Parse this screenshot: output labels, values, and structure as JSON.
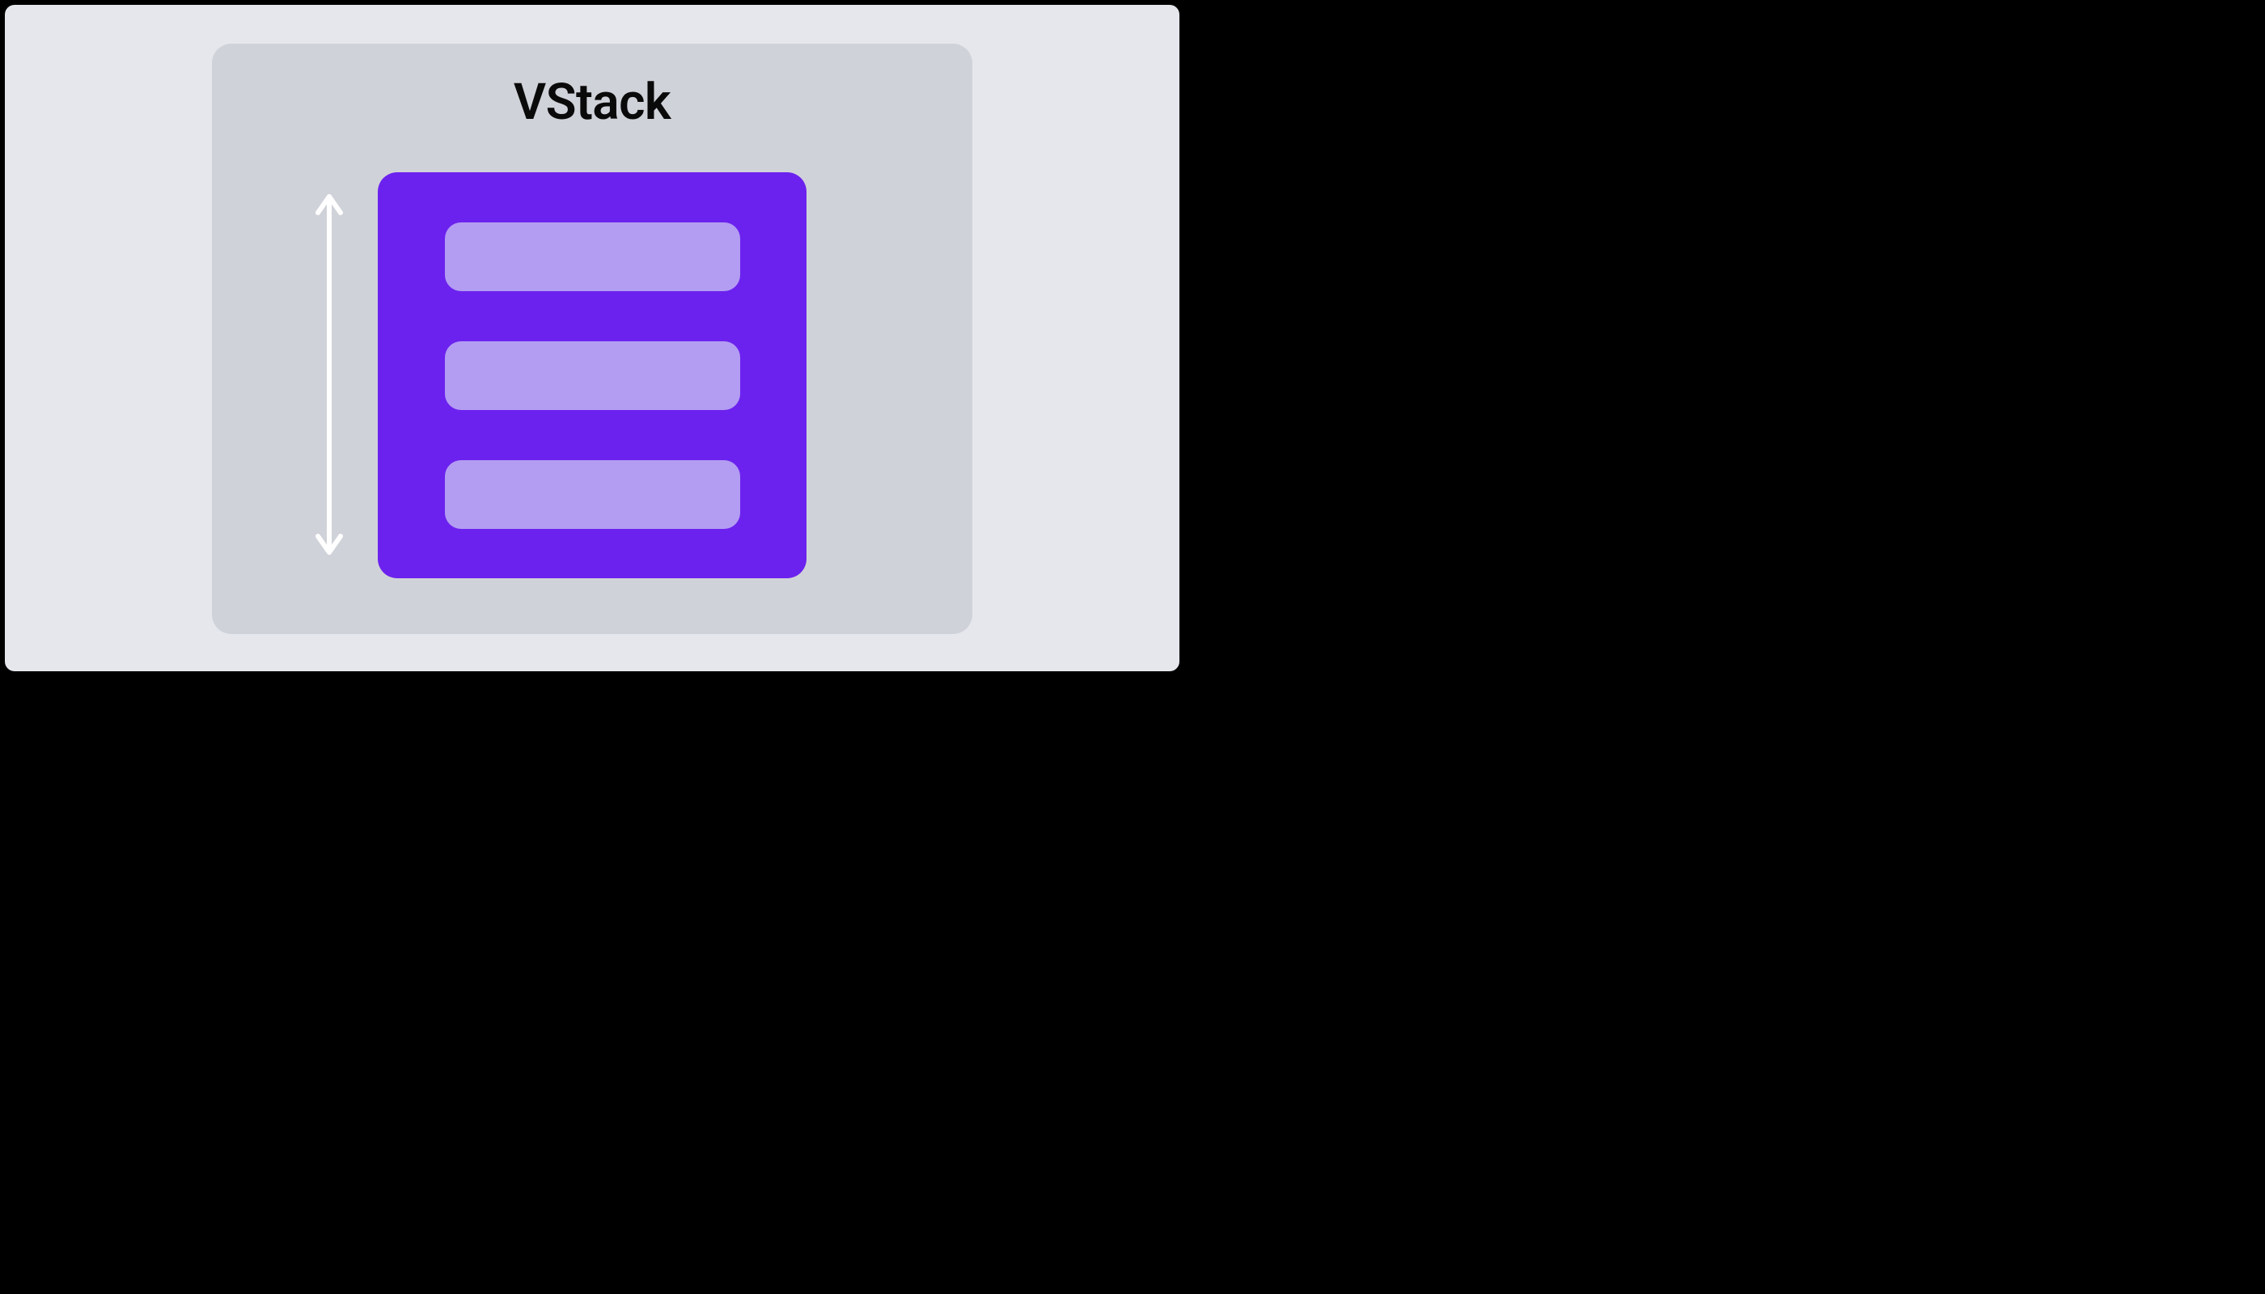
{
  "diagram": {
    "title": "VStack",
    "colors": {
      "page_bg": "#E5E7ED",
      "panel_bg": "#D0D2D9",
      "stack_bg": "#6C22EE",
      "item_bg": "#B39DF2",
      "arrow_stroke": "#FFFFFF",
      "title_color": "#0A0A0A"
    },
    "item_count": 3,
    "direction_indicator": "vertical-double-arrow"
  }
}
